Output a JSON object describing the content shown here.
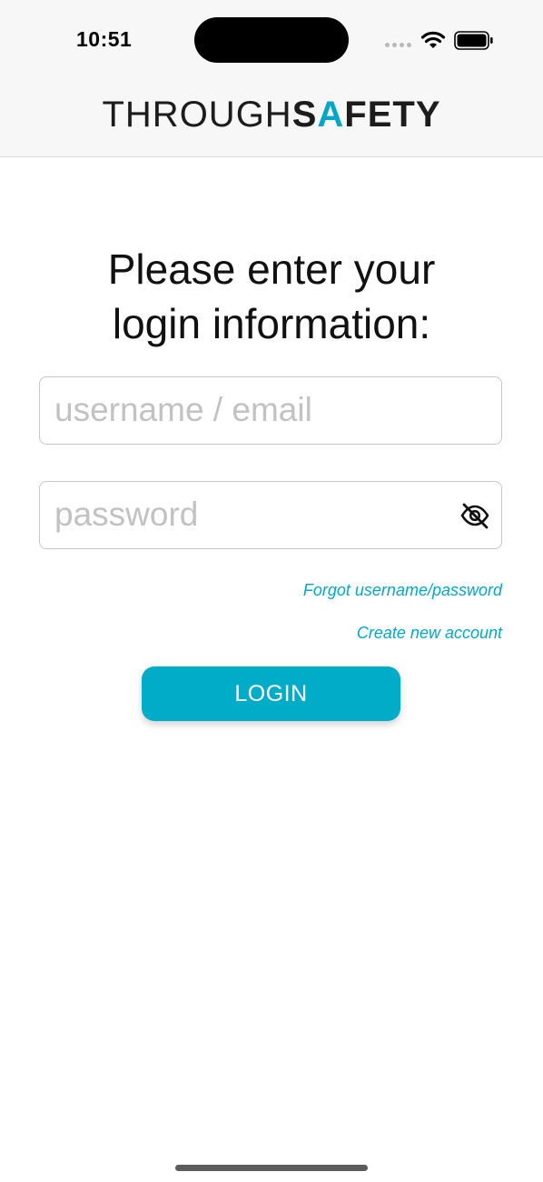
{
  "status_bar": {
    "time": "10:51"
  },
  "logo": {
    "part1": "THROUGH",
    "part2_s": "S",
    "part2_a": "A",
    "part2_rest": "FETY",
    "accent_color": "#00a8c5"
  },
  "form": {
    "title_line1": "Please enter your",
    "title_line2": "login information:",
    "username_placeholder": "username / email",
    "username_value": "",
    "password_placeholder": "password",
    "password_value": "",
    "forgot_link": "Forgot username/password",
    "create_link": "Create new account",
    "login_label": "LOGIN"
  },
  "icons": {
    "password_toggle": "eye-off-icon",
    "wifi": "wifi-icon",
    "battery": "battery-icon"
  },
  "colors": {
    "accent": "#00acc8",
    "header_bg": "#f7f7f8"
  }
}
